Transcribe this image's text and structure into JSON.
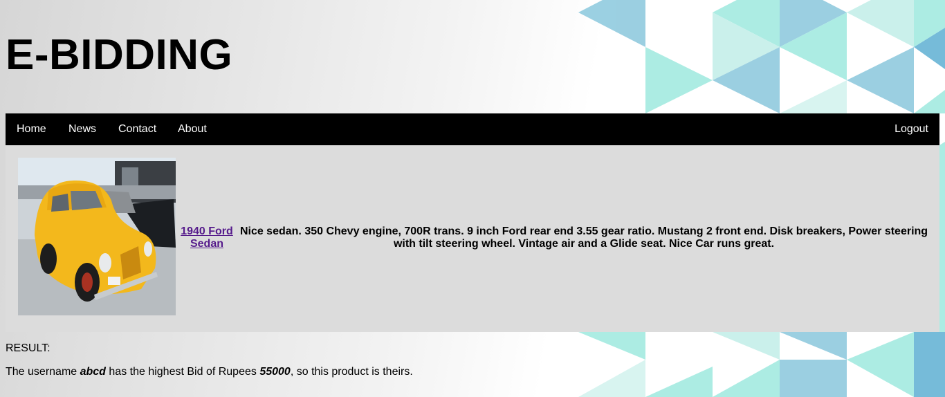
{
  "header": {
    "title": "E-BIDDING"
  },
  "nav": {
    "items": [
      {
        "label": "Home"
      },
      {
        "label": "News"
      },
      {
        "label": "Contact"
      },
      {
        "label": "About"
      }
    ],
    "logout": "Logout"
  },
  "product": {
    "name": "1940 Ford Sedan",
    "description": "Nice sedan. 350 Chevy engine, 700R trans. 9 inch Ford rear end 3.55 gear ratio. Mustang 2 front end. Disk breakers, Power steering with tilt steering wheel. Vintage air and a Glide seat. Nice Car runs great.",
    "image": "yellow-vintage-car-photo"
  },
  "result": {
    "label": "RESULT:",
    "text_prefix": "The username ",
    "username": "abcd",
    "text_middle": " has the highest Bid of Rupees ",
    "amount": "55000",
    "text_suffix": ", so this product is theirs."
  },
  "colors": {
    "navbar": "#000000",
    "product_panel": "#dcdcdc",
    "link": "#551a8b",
    "tri_light": "#a8ebe2",
    "tri_blue": "#96cde0"
  }
}
